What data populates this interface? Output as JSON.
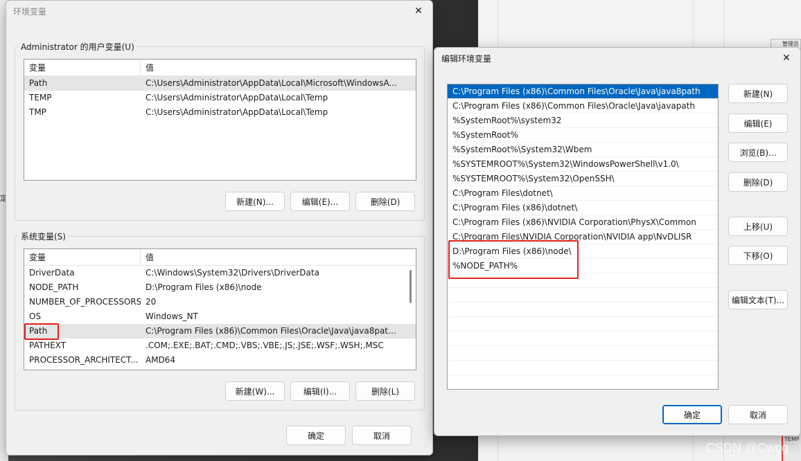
{
  "env_dialog": {
    "title": "环境变量",
    "user_group_label": "Administrator 的用户变量(U)",
    "system_group_label": "系统变量(S)",
    "columns": [
      "变量",
      "值"
    ],
    "user_vars": [
      {
        "name": "Path",
        "value": "C:\\Users\\Administrator\\AppData\\Local\\Microsoft\\WindowsA..."
      },
      {
        "name": "TEMP",
        "value": "C:\\Users\\Administrator\\AppData\\Local\\Temp"
      },
      {
        "name": "TMP",
        "value": "C:\\Users\\Administrator\\AppData\\Local\\Temp"
      }
    ],
    "system_vars": [
      {
        "name": "DriverData",
        "value": "C:\\Windows\\System32\\Drivers\\DriverData"
      },
      {
        "name": "NODE_PATH",
        "value": "D:\\Program Files (x86)\\node"
      },
      {
        "name": "NUMBER_OF_PROCESSORS",
        "value": "20"
      },
      {
        "name": "OS",
        "value": "Windows_NT"
      },
      {
        "name": "Path",
        "value": "C:\\Program Files (x86)\\Common Files\\Oracle\\Java\\java8path;..."
      },
      {
        "name": "PATHEXT",
        "value": ".COM;.EXE;.BAT;.CMD;.VBS;.VBE;.JS;.JSE;.WSF;.WSH;.MSC"
      },
      {
        "name": "PROCESSOR_ARCHITECT...",
        "value": "AMD64"
      }
    ],
    "user_buttons": {
      "new": "新建(N)...",
      "edit": "编辑(E)...",
      "delete": "删除(D)"
    },
    "system_buttons": {
      "new": "新建(W)...",
      "edit": "编辑(I)...",
      "delete": "删除(L)"
    },
    "ok": "确定",
    "cancel": "取消"
  },
  "edit_dialog": {
    "title": "编辑环境变量",
    "entries": [
      "C:\\Program Files (x86)\\Common Files\\Oracle\\Java\\java8path",
      "C:\\Program Files (x86)\\Common Files\\Oracle\\Java\\javapath",
      "%SystemRoot%\\system32",
      "%SystemRoot%",
      "%SystemRoot%\\System32\\Wbem",
      "%SYSTEMROOT%\\System32\\WindowsPowerShell\\v1.0\\",
      "%SYSTEMROOT%\\System32\\OpenSSH\\",
      "C:\\Program Files\\dotnet\\",
      "C:\\Program Files (x86)\\dotnet\\",
      "C:\\Program Files (x86)\\NVIDIA Corporation\\PhysX\\Common",
      "C:\\Program Files\\NVIDIA Corporation\\NVIDIA app\\NvDLISR",
      "D:\\Program Files (x86)\\node\\",
      "%NODE_PATH%"
    ],
    "buttons": {
      "new": "新建(N)",
      "edit": "编辑(E)",
      "browse": "浏览(B)...",
      "delete": "删除(D)",
      "move_up": "上移(U)",
      "move_down": "下移(O)",
      "edit_text": "编辑文本(T)..."
    },
    "ok": "确定",
    "cancel": "取消"
  },
  "background": {
    "left_mark": "定",
    "right_top_text": "管理员",
    "right_bottom_text": "TEMP"
  },
  "watermark": "CSDN @Cwcg"
}
